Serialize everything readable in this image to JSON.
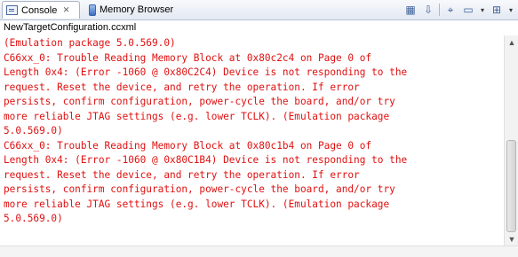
{
  "tabs": [
    {
      "label": "Console",
      "icon": "console-icon",
      "active": true,
      "close": "⨯"
    },
    {
      "label": "Memory Browser",
      "icon": "memory-browser-icon",
      "active": false
    }
  ],
  "toolbar": {
    "icons": [
      "clear-console-icon",
      "scroll-lock-icon",
      "pin-console-icon",
      "display-selected-console-icon",
      "open-console-icon"
    ],
    "dropdown_glyph": "▾"
  },
  "console": {
    "title": "NewTargetConfiguration.ccxml",
    "lines": [
      "(Emulation package 5.0.569.0)",
      "C66xx_0: Trouble Reading Memory Block at 0x80c2c4 on Page 0 of",
      "Length 0x4: (Error -1060 @ 0x80C2C4) Device is not responding to the",
      "request. Reset the device, and retry the operation. If error",
      "persists, confirm configuration, power-cycle the board, and/or try",
      "more reliable JTAG settings (e.g. lower TCLK). (Emulation package",
      "5.0.569.0)",
      "C66xx_0: Trouble Reading Memory Block at 0x80c1b4 on Page 0 of",
      "Length 0x4: (Error -1060 @ 0x80C1B4) Device is not responding to the",
      "request. Reset the device, and retry the operation. If error",
      "persists, confirm configuration, power-cycle the board, and/or try",
      "more reliable JTAG settings (e.g. lower TCLK). (Emulation package",
      "5.0.569.0)"
    ]
  },
  "colors": {
    "error_text": "#e01010"
  }
}
